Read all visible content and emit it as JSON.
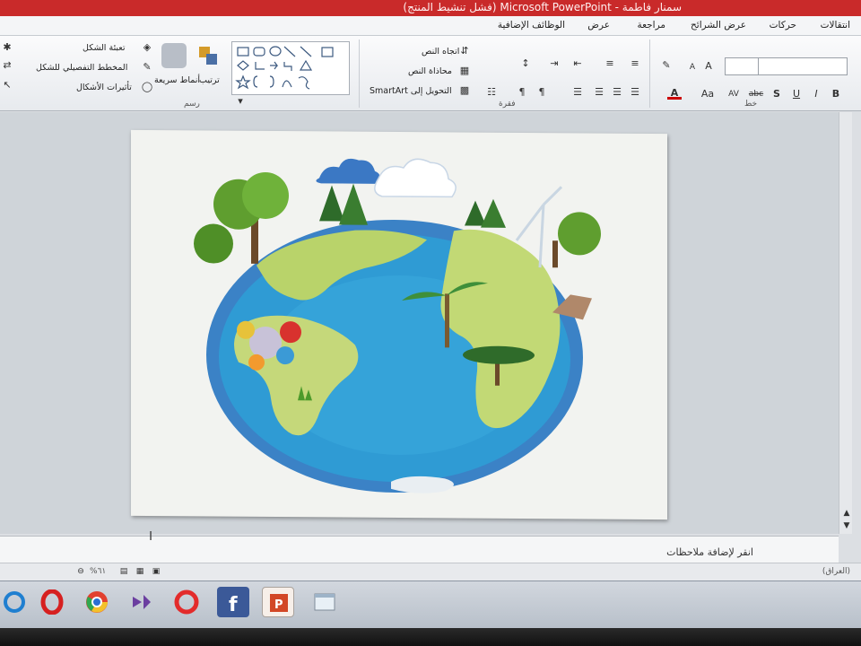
{
  "window": {
    "title": "سمنار فاطمة - Microsoft PowerPoint (فشل تنشيط المنتج)"
  },
  "tabs": [
    "انتقالات",
    "حركات",
    "عرض الشرائح",
    "مراجعة",
    "عرض",
    "الوظائف الإضافية"
  ],
  "ribbon": {
    "font_group_label": "خط",
    "paragraph_group_label": "فقرة",
    "drawing_group_label": "رسم",
    "text_direction": "اتجاه النص",
    "align_text": "محاذاة النص",
    "convert_smartart": "التحويل إلى SmartArt",
    "arrange": "ترتيب",
    "quick_styles": "أنماط سريعة",
    "shape_fill": "تعبئة الشكل",
    "shape_outline": "المخطط التفصيلي للشكل",
    "shape_effects": "تأثيرات الأشكال",
    "font_style_labels": [
      "B",
      "I",
      "U",
      "S",
      "abc",
      "AV",
      "Aa",
      "A"
    ]
  },
  "notes": {
    "placeholder": "انقر لإضافة ملاحظات"
  },
  "status": {
    "zoom": "%٦١",
    "language": "(العراق)"
  },
  "taskbar": {
    "items": [
      "ie-icon",
      "opera-icon",
      "chrome-icon",
      "visual-studio-icon",
      "opera-red-icon",
      "facebook-icon",
      "powerpoint-icon",
      "window-icon"
    ]
  },
  "colors": {
    "titlebar": "#c92a2a",
    "ocean": "#2f8fc7",
    "land": "#b9d36a"
  }
}
